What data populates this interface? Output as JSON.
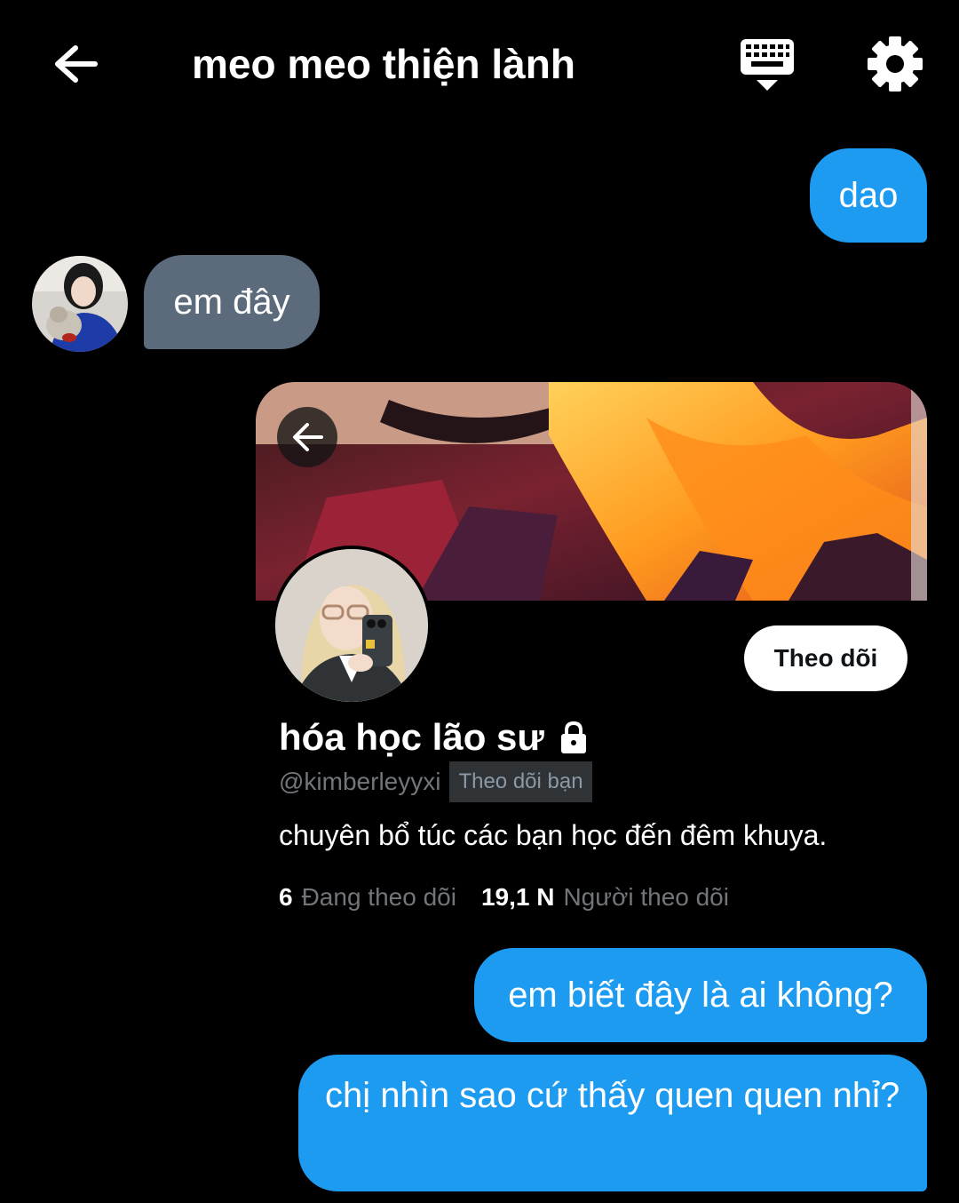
{
  "header": {
    "title": "meo meo thiện lành",
    "back_icon": "arrow-left-icon",
    "keyboard_icon": "keyboard-icon",
    "settings_icon": "gear-icon"
  },
  "messages": [
    {
      "from": "me",
      "text": "dao"
    },
    {
      "from": "contact",
      "text": "em đây"
    },
    {
      "from": "me",
      "text": "em biết đây là ai không?"
    },
    {
      "from": "me",
      "text": "chị nhìn sao cứ thấy quen quen nhỉ?"
    }
  ],
  "profile_card": {
    "display_name": "hóa học lão sư",
    "handle": "@kimberleyyxi",
    "follows_you": "Theo dõi bạn",
    "bio": "chuyên bổ túc các bạn học đến đêm khuya.",
    "follow_button": "Theo dõi",
    "following_count": "6",
    "following_label": "Đang theo dõi",
    "followers_count": "19,1 N",
    "followers_label": "Người theo dõi",
    "protected_icon": "lock-icon"
  },
  "colors": {
    "background": "#000000",
    "outgoing_bubble": "#1d9bf0",
    "incoming_bubble": "#5b6b7b",
    "secondary_text": "#71767b"
  }
}
